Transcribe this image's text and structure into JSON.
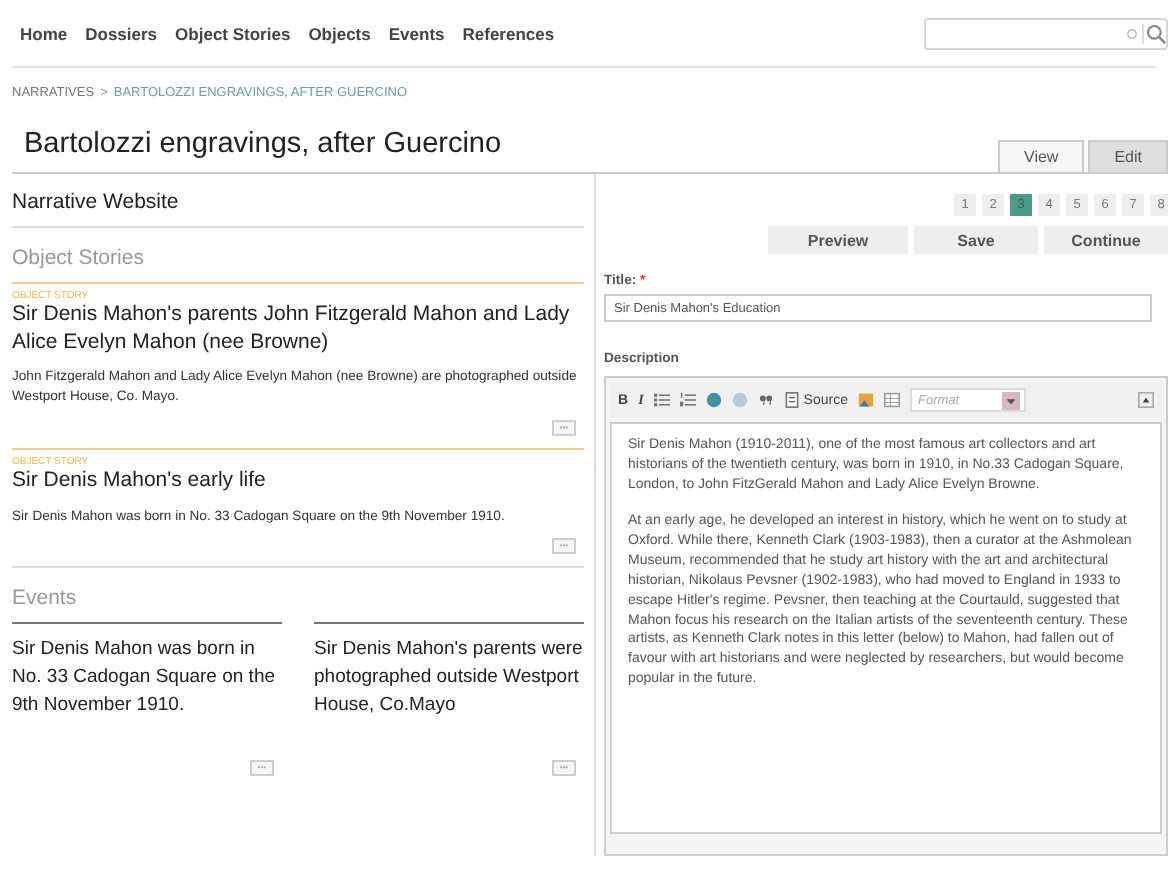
{
  "nav": {
    "links": [
      "Home",
      "Dossiers",
      "Object Stories",
      "Objects",
      "Events",
      "References"
    ]
  },
  "breadcrumb": {
    "parent": "NARRATIVES",
    "separator": ">",
    "current": "BARTOLOZZI ENGRAVINGS, AFTER GUERCINO"
  },
  "page_title": "Bartolozzi engravings, after Guercino",
  "view_tabs": [
    {
      "label": "View",
      "selected": false
    },
    {
      "label": "Edit",
      "selected": true
    }
  ],
  "section_title": "Narrative Website",
  "object_stories": {
    "heading": "Object Stories",
    "items": [
      {
        "label": "OBJECT STORY",
        "title": "Sir Denis Mahon's parents John Fitzgerald Mahon and Lady Alice Evelyn Mahon (nee Browne)",
        "description": "John Fitzgerald Mahon and Lady Alice Evelyn Mahon (nee Browne) are photographed outside Westport House, Co. Mayo.",
        "more": "•••"
      },
      {
        "label": "OBJECT STORY",
        "title": "Sir Denis Mahon's early life",
        "description": "Sir Denis Mahon was born in No. 33 Cadogan Square on the 9th November 1910.",
        "more": "•••"
      }
    ]
  },
  "events": {
    "heading": "Events",
    "items": [
      {
        "title": "Sir Denis Mahon was born in No. 33 Cadogan Square on the 9th November 1910.",
        "more": "•••"
      },
      {
        "title": "Sir Denis Mahon's parents were photographed outside Westport House, Co.Mayo",
        "more": "•••"
      }
    ]
  },
  "pages": [
    {
      "label": "1",
      "selected": false
    },
    {
      "label": "2",
      "selected": false
    },
    {
      "label": "3",
      "selected": true
    },
    {
      "label": "4",
      "selected": false
    },
    {
      "label": "5",
      "selected": false
    },
    {
      "label": "6",
      "selected": false
    },
    {
      "label": "7",
      "selected": false
    },
    {
      "label": "8",
      "selected": false
    }
  ],
  "actions": [
    "Preview",
    "Save",
    "Continue"
  ],
  "form": {
    "title_label": "Title:",
    "required_mark": "*",
    "title_value": "Sir Denis Mahon's Education",
    "description_label": "Description",
    "toolbar": {
      "bold": "B",
      "italic": "I",
      "source": "Source",
      "format_placeholder": "Format"
    },
    "paragraphs": [
      "Sir Denis Mahon (1910-2011), one of the most famous art collectors and art historians of the twentieth century, was born in 1910, in No.33 Cadogan Square, London, to John FitzGerald Mahon and Lady Alice Evelyn Browne.",
      "At an early age, he developed an interest in history, which he went on to study at Oxford. While there, Kenneth Clark (1903-1983), then a curator at the Ashmolean Museum, recommended that he study art history with the art and architectural historian, Nikolaus Pevsner (1902-1983), who had moved to England in 1933 to escape Hitler's regime. Pevsner, then teaching at the Courtauld, suggested that Mahon focus his research on the Italian artists of the seventeenth century. These artists, as Kenneth Clark notes in this letter (below) to Mahon, had fallen out of favour with art historians and were neglected by researchers, but would become popular in the future."
    ]
  }
}
